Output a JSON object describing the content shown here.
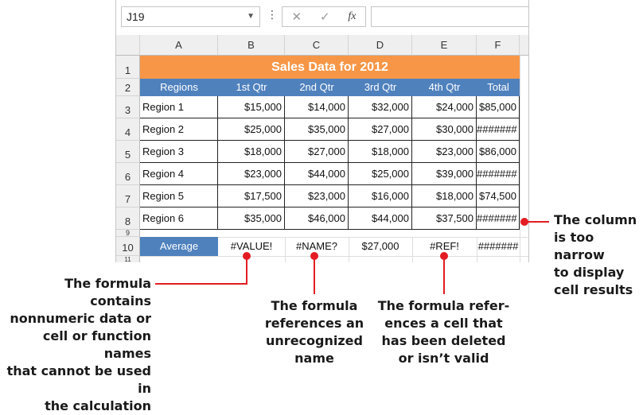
{
  "formula_bar": {
    "name_box": "J19",
    "cancel_icon": "✕",
    "enter_icon": "✓",
    "fx_label": "fx",
    "formula_value": ""
  },
  "columns": [
    "A",
    "B",
    "C",
    "D",
    "E",
    "F"
  ],
  "rows": [
    "1",
    "2",
    "3",
    "4",
    "5",
    "6",
    "7",
    "8",
    "9",
    "10",
    "11"
  ],
  "sheet": {
    "title": "Sales Data for 2012",
    "headers": [
      "Regions",
      "1st Qtr",
      "2nd Qtr",
      "3rd Qtr",
      "4th Qtr",
      "Total"
    ],
    "data": [
      [
        "Region 1",
        "$15,000",
        "$14,000",
        "$32,000",
        "$24,000",
        "$85,000"
      ],
      [
        "Region 2",
        "$25,000",
        "$35,000",
        "$27,000",
        "$30,000",
        "#######"
      ],
      [
        "Region 3",
        "$18,000",
        "$27,000",
        "$18,000",
        "$23,000",
        "$86,000"
      ],
      [
        "Region 4",
        "$23,000",
        "$44,000",
        "$25,000",
        "$39,000",
        "#######"
      ],
      [
        "Region 5",
        "$17,500",
        "$23,000",
        "$16,000",
        "$18,000",
        "$74,500"
      ],
      [
        "Region 6",
        "$35,000",
        "$46,000",
        "$44,000",
        "$37,500",
        "#######"
      ]
    ],
    "average": [
      "Average",
      "#VALUE!",
      "#NAME?",
      "$27,000",
      "#REF!",
      "#######"
    ]
  },
  "callouts": {
    "value_error": [
      "The formula contains",
      "nonnumeric data or",
      "cell or function names",
      "that cannot be used in",
      "the calculation"
    ],
    "name_error": [
      "The formula",
      "references an",
      "unrecognized",
      "name"
    ],
    "ref_error": [
      "The formula refer-",
      "ences a cell that",
      "has been deleted",
      "or isn’t valid"
    ],
    "narrow_column": [
      "The column",
      "is too narrow",
      "to display",
      "cell results"
    ]
  },
  "colors": {
    "title_fill": "#f79646",
    "header_fill": "#4f81bd",
    "callout_red": "#e31c23"
  }
}
